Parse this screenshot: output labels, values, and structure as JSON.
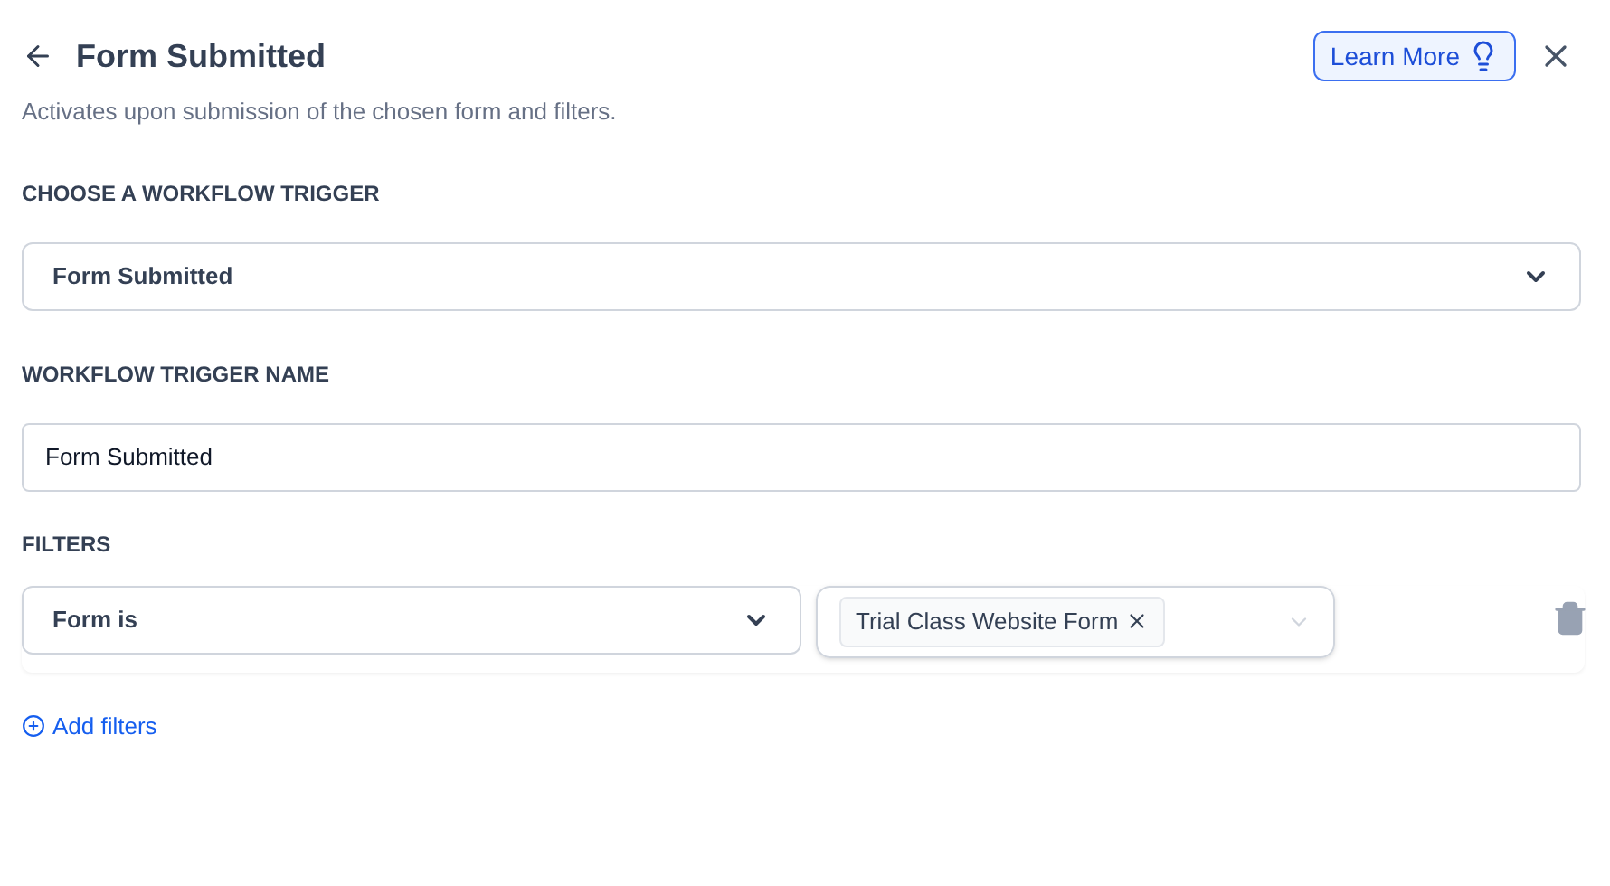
{
  "header": {
    "title": "Form Submitted",
    "learn_more": "Learn More",
    "description": "Activates upon submission of the chosen form and filters."
  },
  "trigger": {
    "label": "CHOOSE A WORKFLOW TRIGGER",
    "value": "Form Submitted"
  },
  "trigger_name": {
    "label": "WORKFLOW TRIGGER NAME",
    "value": "Form Submitted"
  },
  "filters": {
    "label": "FILTERS",
    "rows": [
      {
        "field": "Form is",
        "tags": [
          "Trial Class Website Form"
        ]
      }
    ],
    "add": "Add filters"
  }
}
